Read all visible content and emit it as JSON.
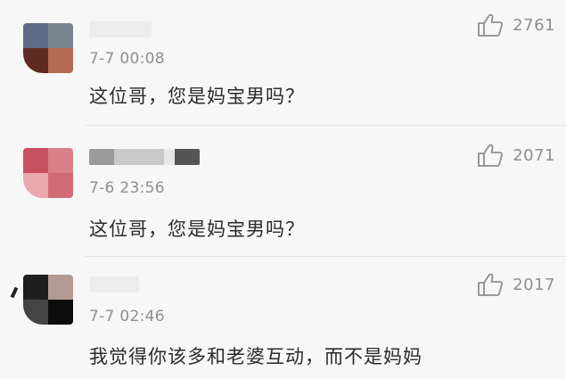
{
  "comments": [
    {
      "time": "7-7 00:08",
      "text": "这位哥，您是妈宝男吗？",
      "likes": "2761",
      "avatar_colors": [
        "#5d6b86",
        "#7c8390",
        "#5e2a22",
        "#b76b52"
      ]
    },
    {
      "time": "7-6 23:56",
      "text": "这位哥，您是妈宝男吗？",
      "likes": "2071",
      "avatar_colors": [
        "#c8505e",
        "#d98088",
        "#e8a8ac",
        "#d16c74"
      ]
    },
    {
      "time": "7-7 02:46",
      "text": "我觉得你该多和老婆互动，而不是妈妈",
      "likes": "2017",
      "avatar_colors": [
        "#1f1f1f",
        "#b49a92",
        "#444444",
        "#0d0d0d"
      ]
    }
  ],
  "icons": {
    "like": "thumbs-up-icon"
  }
}
